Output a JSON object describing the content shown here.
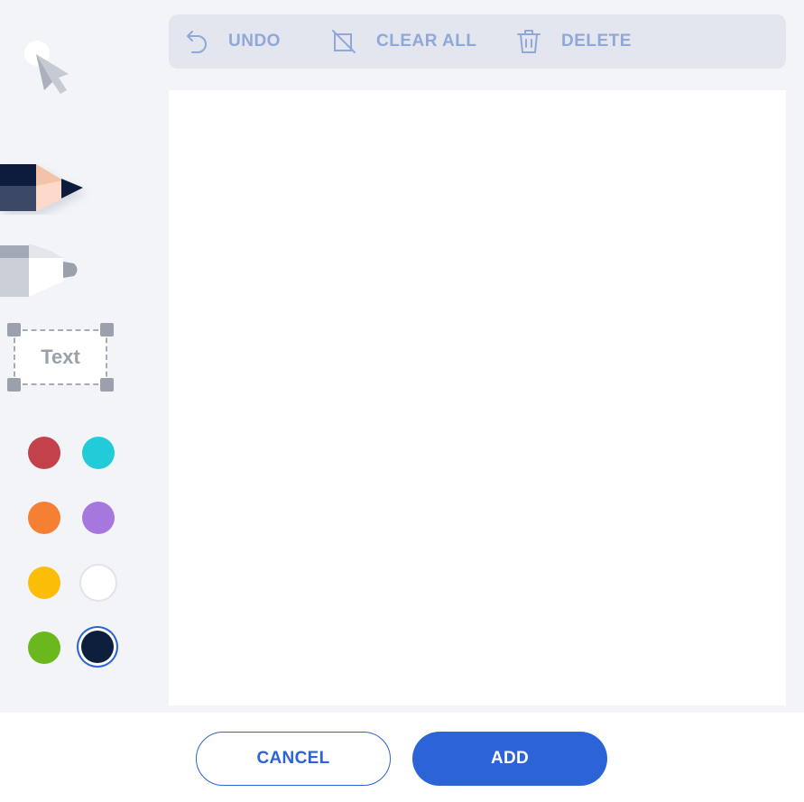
{
  "toolbar": {
    "undo_label": "UNDO",
    "clear_all_label": "CLEAR ALL",
    "delete_label": "DELETE"
  },
  "tools": {
    "pointer": "pointer-icon",
    "pencil": "pencil-icon",
    "marker": "marker-icon",
    "text_label": "Text"
  },
  "colors": {
    "red": "#c2414b",
    "cyan": "#22cbd8",
    "orange": "#f57f33",
    "purple": "#a678de",
    "yellow": "#fbbd08",
    "white": "#ffffff",
    "green": "#6ab81e",
    "navy": "#0d1f3c",
    "selected": "navy",
    "accent": "#2c63d6"
  },
  "footer": {
    "cancel_label": "CANCEL",
    "add_label": "ADD"
  }
}
